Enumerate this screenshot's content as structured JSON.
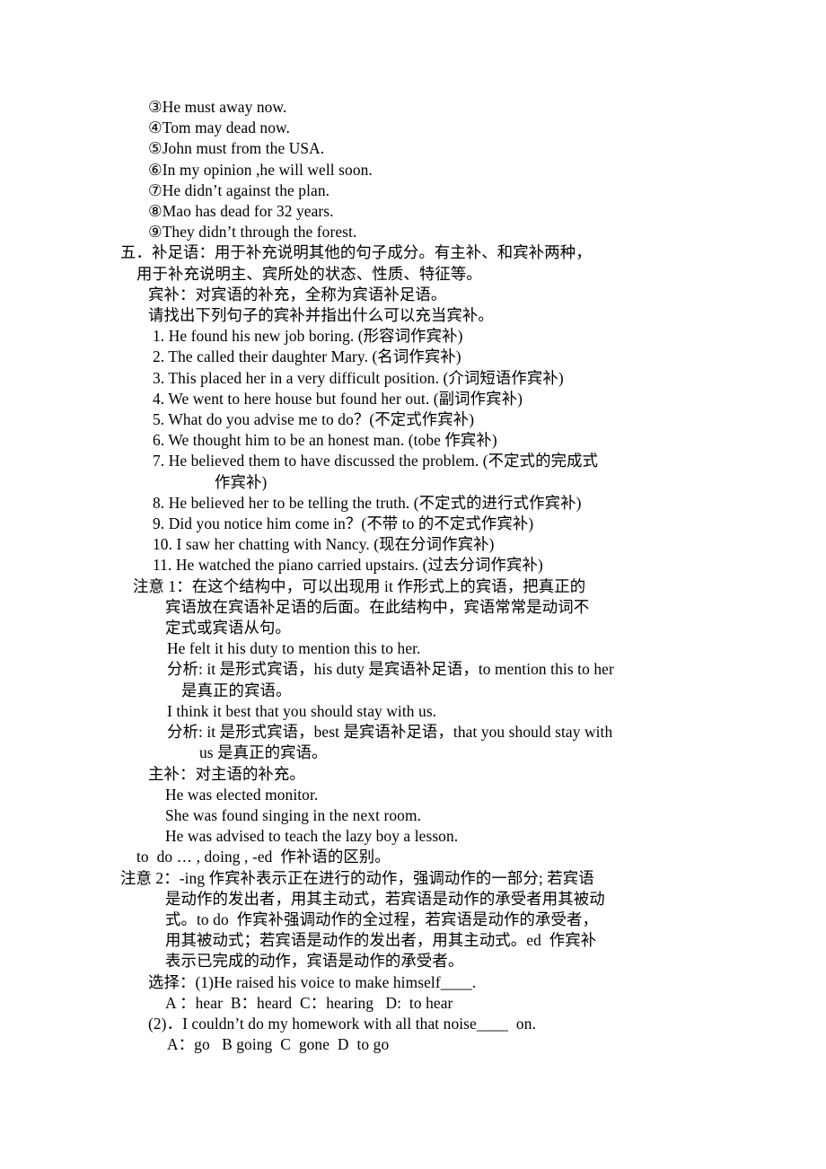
{
  "document": {
    "type": "grammar-study-notes",
    "language": "zh-CN + en",
    "lines": {
      "ex3": "③He must away now.",
      "ex4": "④Tom may dead now.",
      "ex5": "⑤John must from the USA.",
      "ex6": "⑥In my opinion ,he will well soon.",
      "ex7": "⑦He didn’t against the plan.",
      "ex8": "⑧Mao has dead for 32 years.",
      "ex9": "⑨They didn’t through the forest.",
      "section5_a": "五．补足语：用于补充说明其他的句子成分。有主补、和宾补两种，",
      "section5_b": "用于补充说明主、宾所处的状态、性质、特征等。",
      "binbu_def": "宾补：对宾语的补充，全称为宾语补足语。",
      "binbu_task": "请找出下列句子的宾补并指出什么可以充当宾补。",
      "q1": "1. He found his new job boring. (形容词作宾补)",
      "q2": "2. The called their daughter Mary. (名词作宾补)",
      "q3": "3. This placed her in a very difficult position. (介词短语作宾补)",
      "q4": "4. We went to here house but found her out. (副词作宾补)",
      "q5": "5. What do you advise me to do？(不定式作宾补)",
      "q6": "6. We thought him to be an honest man. (tobe 作宾补)",
      "q7a": "7. He believed them to have discussed the problem. (不定式的完成式",
      "q7b": "作宾补)",
      "q8": "8. He believed her to be telling the truth. (不定式的进行式作宾补)",
      "q9": "9. Did you notice him come in？(不带 to 的不定式作宾补)",
      "q10": "10. I saw her chatting with Nancy. (现在分词作宾补)",
      "q11": "11. He watched the piano carried upstairs. (过去分词作宾补)",
      "note1_a": "注意 1：在这个结构中，可以出现用 it 作形式上的宾语，把真正的",
      "note1_b": "宾语放在宾语补足语的后面。在此结构中，宾语常常是动词不",
      "note1_c": "定式或宾语从句。",
      "note1_ex1": "He felt it his duty to mention this to her.",
      "note1_an1a": "分析: it 是形式宾语，his duty 是宾语补足语，to mention this to her",
      "note1_an1b": "是真正的宾语。",
      "note1_ex2": "I think it best that you should stay with us.",
      "note1_an2a": "分析: it 是形式宾语，best 是宾语补足语，that you should stay with",
      "note1_an2b": "us 是真正的宾语。",
      "zhubu_def": "主补：对主语的补充。",
      "zhubu_ex1": "He was elected monitor.",
      "zhubu_ex2": "She was found singing in the next room.",
      "zhubu_ex3": "He was advised to teach the lazy boy a lesson.",
      "todo_line": "to  do … , doing , -ed  作补语的区别。",
      "note2_a": "注意 2：-ing 作宾补表示正在进行的动作，强调动作的一部分; 若宾语",
      "note2_b": "是动作的发出者，用其主动式，若宾语是动作的承受者用其被动",
      "note2_c": "式。to do  作宾补强调动作的全过程，若宾语是动作的承受者，",
      "note2_d": "用其被动式；若宾语是动作的发出者，用其主动式。ed  作宾补",
      "note2_e": "表示已完成的动作，宾语是动作的承受者。",
      "choice_q1": "选择：(1)He raised his voice to make himself____.",
      "choice_q1_options": "A ：hear  B：heard  C：hearing   D:  to hear",
      "choice_q2": "(2)．I couldn’t do my homework with all that noise____  on.",
      "choice_q2_options": "A：go   B going  C  gone  D  to go"
    }
  }
}
